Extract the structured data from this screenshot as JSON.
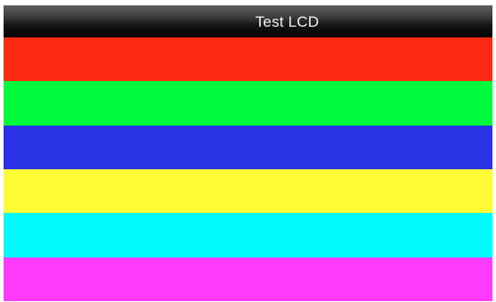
{
  "title_bar": {
    "title": "Test LCD"
  },
  "color_bars": [
    {
      "name": "red",
      "color": "#ff2a14"
    },
    {
      "name": "green",
      "color": "#00fb3c"
    },
    {
      "name": "blue",
      "color": "#2a33e6"
    },
    {
      "name": "yellow",
      "color": "#fffb36"
    },
    {
      "name": "cyan",
      "color": "#00fcfa"
    },
    {
      "name": "magenta",
      "color": "#ff3bfb"
    }
  ]
}
